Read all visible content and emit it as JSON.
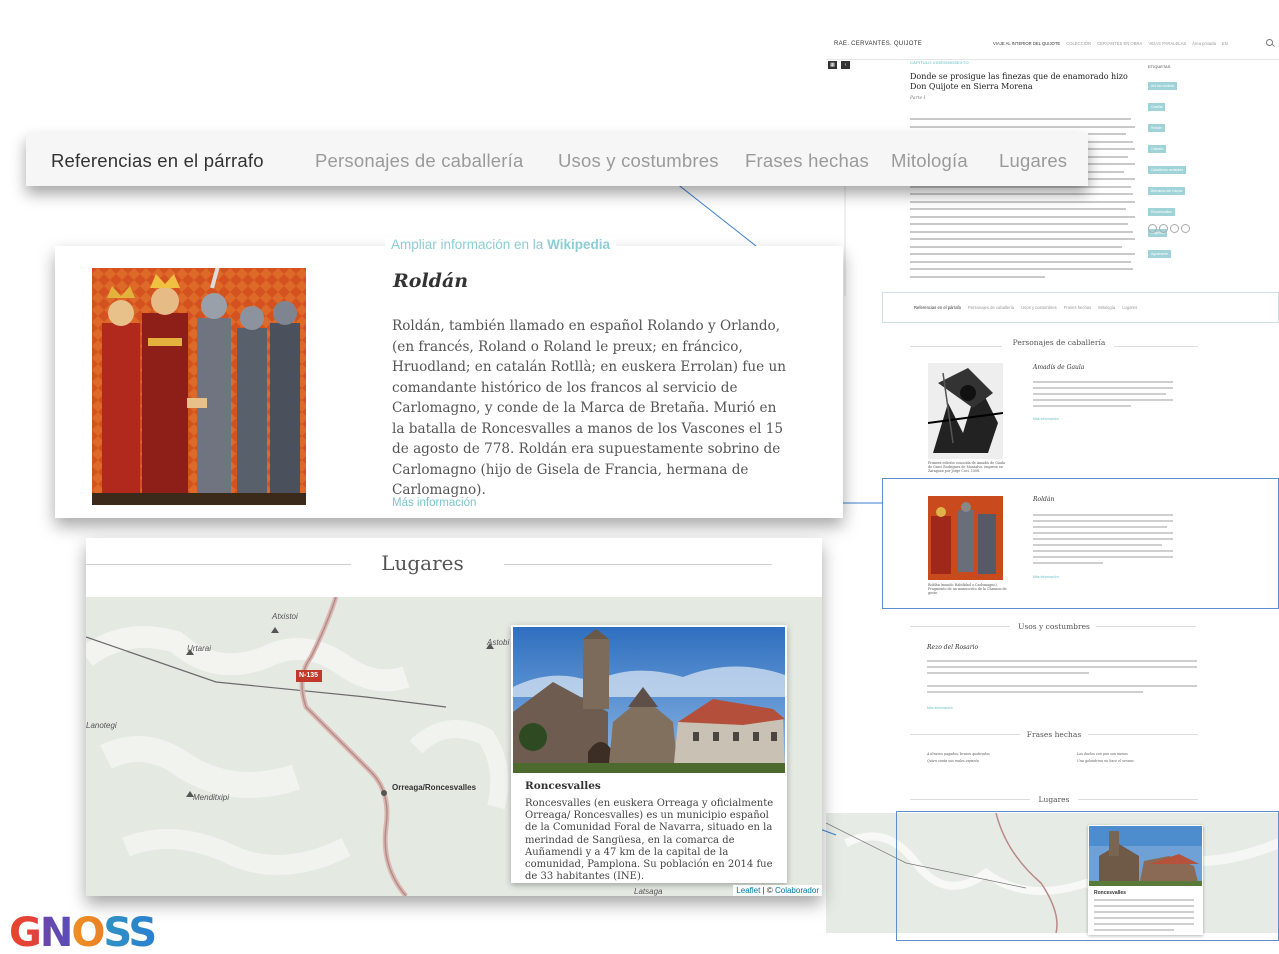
{
  "site": {
    "brand": "RAE. CERVANTES. QUIJOTE",
    "nav": [
      "VIAJE AL INTERIOR DEL QUIJOTE",
      "COLECCIÓN",
      "CERVANTES EN OBRA",
      "VIDAS PARALELAS",
      "Área privada",
      "EN"
    ],
    "chapter_label": "CAPÍTULO VIGÉSIMOSEXTO",
    "chapter_title": "Donde se prosigue las finezas que de enamorado hizo Don Quijote en Sierra Morena",
    "part": "Parte I",
    "paragraph": "Y volviendo a contar lo que hizo el de la triste figura después que se vio solo, dice la historia que así como Don Quijote acabó de dar las tumbas, o vueltas de medio abajo desnudo, y de medio arriba vestido...",
    "tags_title": "ETIQUETAS",
    "tags": [
      "Ars las tumbas",
      "Castilla",
      "Roldán",
      "Orlando",
      "Caballeros andantes",
      "Bernardo del Carpio",
      "Roncesvalles",
      "Angélica",
      "Agramante"
    ]
  },
  "ref_tabs": [
    "Referencias en el párrafo",
    "Personajes de caballería",
    "Usos y costumbres",
    "Frases hechas",
    "Mitología",
    "Lugares"
  ],
  "roldan_card": {
    "wiki_prefix": "Ampliar información en la",
    "wiki_name": "Wikipedia",
    "name": "Roldán",
    "description": "Roldán, también llamado en español Rolando y Orlando, (en francés, Roland o Roland le preux; en fráncico, Hruodland; en catalán Rotllà; en euskera Errolan) fue un comandante histórico de los francos al servicio de Carlomagno, y conde de la Marca de Bretaña. Murió en la batalla de Roncesvalles a manos de los Vascones el 15 de agosto de 778. Roldán era supuestamente sobrino de Carlomagno (hijo de Gisela de Francia, hermana de Carlomagno).",
    "more": "Más información"
  },
  "mini_sections": {
    "caballeria": "Personajes de caballería",
    "amadis_title": "Amadís de Gaula",
    "amadis_caption": "Primera edición conocida de Amadís de Gaula de Garci Rodríguez de Montalvo, impresa en Zaragoza por Jorge Coci, 1508.",
    "roldan_title": "Roldán",
    "roldan_caption": "Roldán (mundo Habilidad o Carlomagno). Fragmento de un manuscrito de la Chanson de geste.",
    "usos": "Usos y costumbres",
    "rezo_title": "Rezo del Rosario",
    "frases": "Frases hechas",
    "frase1": "A dineros pagados, brazos quebrados",
    "frase2": "Quien canta sus males espanta",
    "frase3": "Los duelos con pan son menos",
    "frase4": "Una golondrina no hace el verano",
    "lugares": "Lugares"
  },
  "lugares_card": {
    "title": "Lugares",
    "map_labels": [
      "Urtarai",
      "Atxistoi",
      "Astobi",
      "Lanotegi",
      "Menditxipi",
      "Orreaga/Roncesvalles",
      "N-135",
      "Latsaga"
    ],
    "popup_name": "Roncesvalles",
    "popup_desc": "Roncesvalles (en euskera Orreaga y oficialmente Orreaga/ Roncesvalles) es un municipio español de la Comunidad Foral de Navarra, situado en la merindad de Sangüesa, en la comarca de Auñamendi y a 47 km de la capital de la comunidad, Pamplona. Su población en 2014 fue de 33 habitantes (INE).",
    "attrib_leaflet": "Leaflet",
    "attrib_sep": " | © ",
    "attrib_contrib": "Colaborador"
  },
  "logo": "GNOSS",
  "colors": {
    "accent": "#7bc4cc",
    "callout_line": "#3a7fd0"
  }
}
